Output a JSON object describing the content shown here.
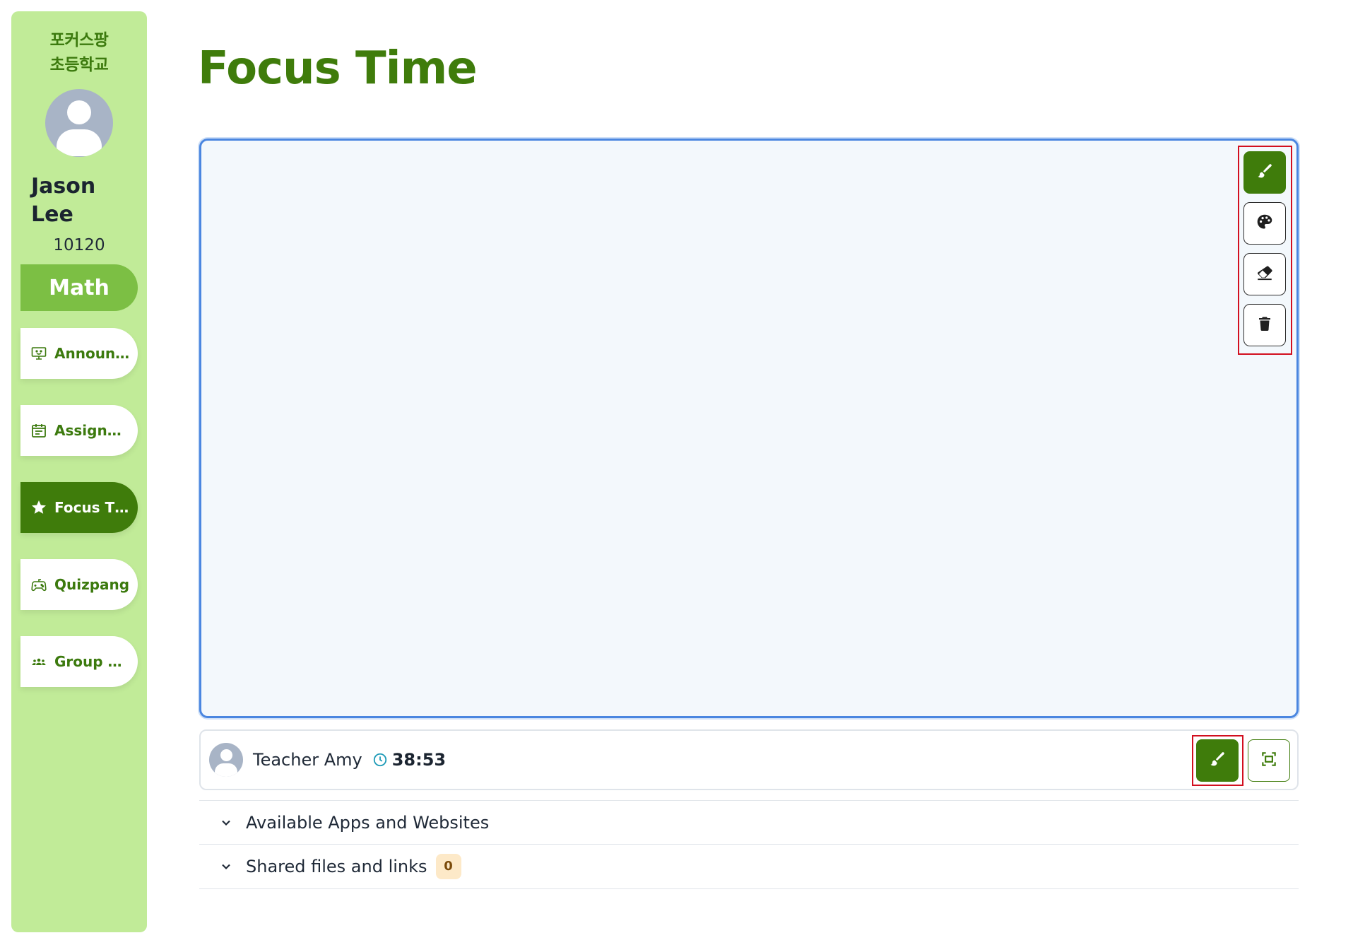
{
  "sidebar": {
    "school_line1": "포커스팡",
    "school_line2": "초등학교",
    "student_name": "Jason Lee",
    "student_id": "10120",
    "subject": "Math",
    "items": [
      {
        "label": "Announcements",
        "icon": "presentation-icon",
        "active": false
      },
      {
        "label": "Assignments",
        "icon": "calendar-icon",
        "active": false
      },
      {
        "label": "Focus Time",
        "icon": "star-icon",
        "active": true
      },
      {
        "label": "Quizpang",
        "icon": "gamepad-icon",
        "active": false
      },
      {
        "label": "Group Activities",
        "icon": "group-icon",
        "active": false
      }
    ]
  },
  "main": {
    "title": "Focus Time",
    "canvas_tools": [
      {
        "name": "brush",
        "icon": "brush-icon",
        "active": true
      },
      {
        "name": "palette",
        "icon": "palette-icon",
        "active": false
      },
      {
        "name": "eraser",
        "icon": "eraser-icon",
        "active": false
      },
      {
        "name": "clear",
        "icon": "trash-icon",
        "active": false
      }
    ],
    "teacher": {
      "name": "Teacher Amy",
      "timer": "38:53"
    },
    "accordions": [
      {
        "label": "Available Apps and Websites"
      },
      {
        "label": "Shared files and links",
        "badge": "0"
      }
    ]
  },
  "colors": {
    "sidebar_bg": "#c1eb98",
    "brand_green": "#3f7c0b",
    "subject_green": "#7cbf44",
    "canvas_border": "#4a86e0",
    "highlight_red": "#d20f1f"
  }
}
